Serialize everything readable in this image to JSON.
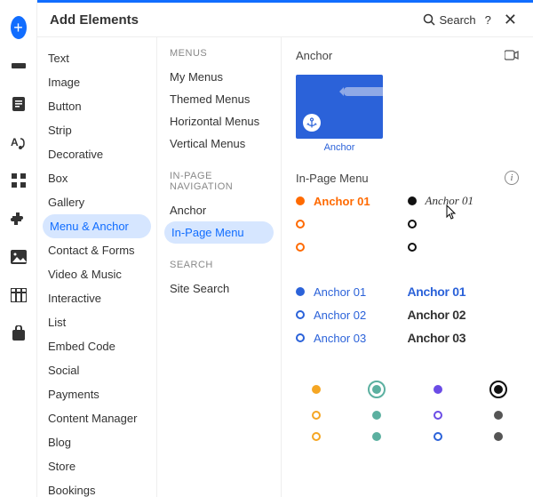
{
  "header": {
    "title": "Add Elements",
    "search": "Search",
    "help": "?",
    "close": "✕"
  },
  "rail": [
    {
      "name": "add-icon",
      "isPlus": true
    },
    {
      "name": "section-icon"
    },
    {
      "name": "page-icon"
    },
    {
      "name": "design-icon"
    },
    {
      "name": "apps-icon"
    },
    {
      "name": "addons-icon"
    },
    {
      "name": "media-icon"
    },
    {
      "name": "data-icon"
    },
    {
      "name": "store-icon"
    }
  ],
  "categories": [
    "Text",
    "Image",
    "Button",
    "Strip",
    "Decorative",
    "Box",
    "Gallery",
    "Menu & Anchor",
    "Contact & Forms",
    "Video & Music",
    "Interactive",
    "List",
    "Embed Code",
    "Social",
    "Payments",
    "Content Manager",
    "Blog",
    "Store",
    "Bookings"
  ],
  "selectedCategoryIndex": 7,
  "sub": [
    {
      "type": "label",
      "text": "MENUS"
    },
    {
      "type": "item",
      "text": "My Menus"
    },
    {
      "type": "item",
      "text": "Themed Menus"
    },
    {
      "type": "item",
      "text": "Horizontal Menus"
    },
    {
      "type": "item",
      "text": "Vertical Menus"
    },
    {
      "type": "gap"
    },
    {
      "type": "label",
      "text": "IN-PAGE NAVIGATION"
    },
    {
      "type": "item",
      "text": "Anchor"
    },
    {
      "type": "item",
      "text": "In-Page Menu",
      "selected": true
    },
    {
      "type": "gap"
    },
    {
      "type": "label",
      "text": "SEARCH"
    },
    {
      "type": "item",
      "text": "Site Search"
    }
  ],
  "preview": {
    "anchorTitle": "Anchor",
    "anchorCaption": "Anchor",
    "inPageTitle": "In-Page Menu",
    "samples": {
      "orange": {
        "a": "Anchor 01"
      },
      "italic": {
        "a": "Anchor 01"
      },
      "blue": {
        "a": "Anchor 01",
        "b": "Anchor 02",
        "c": "Anchor 03"
      },
      "cond": {
        "a": "Anchor 01",
        "b": "Anchor 02",
        "c": "Anchor 03"
      }
    },
    "dotColors": {
      "amber": "#f5a623",
      "teal": "#5bb0a0",
      "violet": "#6b4ce6",
      "black": "#111",
      "blue": "#2b62d9",
      "grey": "#555"
    }
  }
}
